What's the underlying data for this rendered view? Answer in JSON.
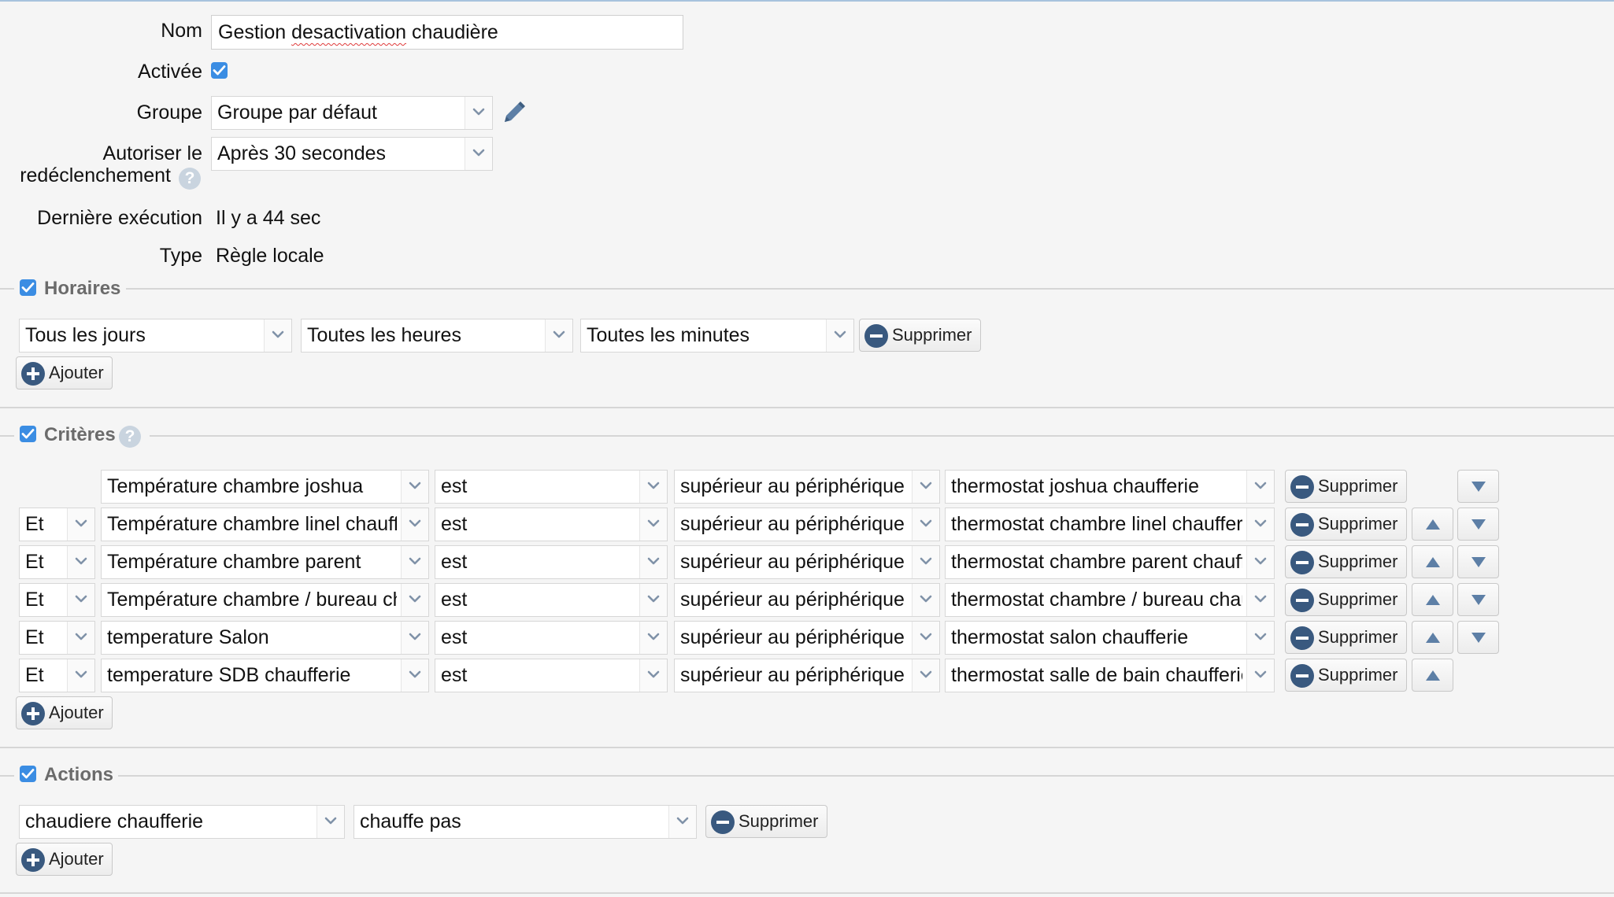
{
  "form": {
    "nom_label": "Nom",
    "nom_value_pre": "Gestion ",
    "nom_value_misspelled": "desactivation",
    "nom_value_post": " chaudière",
    "activee_label": "Activée",
    "activee_checked": true,
    "groupe_label": "Groupe",
    "groupe_value": "Groupe par défaut",
    "autoriser_label_line1": "Autoriser le",
    "autoriser_label_line2": "redéclenchement",
    "autoriser_value": "Après 30 secondes",
    "derniere_label": "Dernière exécution",
    "derniere_value": "Il y a 44 sec",
    "type_label": "Type",
    "type_value": "Règle locale"
  },
  "horaires": {
    "title": "Horaires",
    "checked": true,
    "row": {
      "jours": "Tous les jours",
      "heures": "Toutes les heures",
      "minutes": "Toutes les minutes",
      "delete_label": "Supprimer"
    },
    "add_label": "Ajouter"
  },
  "criteres": {
    "title": "Critères",
    "checked": true,
    "delete_label": "Supprimer",
    "add_label": "Ajouter",
    "rows": [
      {
        "logic": "",
        "device": "Température chambre joshua",
        "op": "est",
        "compare": "supérieur au périphérique",
        "target": "thermostat joshua chaufferie",
        "up": false,
        "down": true
      },
      {
        "logic": "Et",
        "device": "Température chambre linel chauffe",
        "op": "est",
        "compare": "supérieur au périphérique",
        "target": "thermostat chambre linel chaufferie",
        "up": true,
        "down": true
      },
      {
        "logic": "Et",
        "device": "Température chambre parent",
        "op": "est",
        "compare": "supérieur au périphérique",
        "target": "thermostat chambre parent chauffe",
        "up": true,
        "down": true
      },
      {
        "logic": "Et",
        "device": "Température chambre / bureau cha",
        "op": "est",
        "compare": "supérieur au périphérique",
        "target": "thermostat chambre / bureau chau",
        "up": true,
        "down": true
      },
      {
        "logic": "Et",
        "device": "temperature Salon",
        "op": "est",
        "compare": "supérieur au périphérique",
        "target": "thermostat salon chaufferie",
        "up": true,
        "down": true
      },
      {
        "logic": "Et",
        "device": "temperature SDB chaufferie",
        "op": "est",
        "compare": "supérieur au périphérique",
        "target": "thermostat salle de bain chaufferie",
        "up": true,
        "down": false
      }
    ]
  },
  "actions": {
    "title": "Actions",
    "checked": true,
    "row": {
      "device": "chaudiere chaufferie",
      "action": "chauffe pas",
      "delete_label": "Supprimer"
    },
    "add_label": "Ajouter"
  },
  "colors": {
    "checkbox": "#3b8de3",
    "button_icon": "#39597f",
    "help_icon": "#c9d4df",
    "section_title": "#6b6b6b",
    "top_border": "#a7c3dd"
  },
  "icons": {
    "checkbox": "checkmark-icon",
    "help": "question-mark-icon",
    "edit": "pencil-icon",
    "add": "plus-circle-icon",
    "delete": "minus-circle-icon",
    "dropdown": "chevron-down-icon",
    "move_up": "triangle-up-icon",
    "move_down": "triangle-down-icon"
  }
}
